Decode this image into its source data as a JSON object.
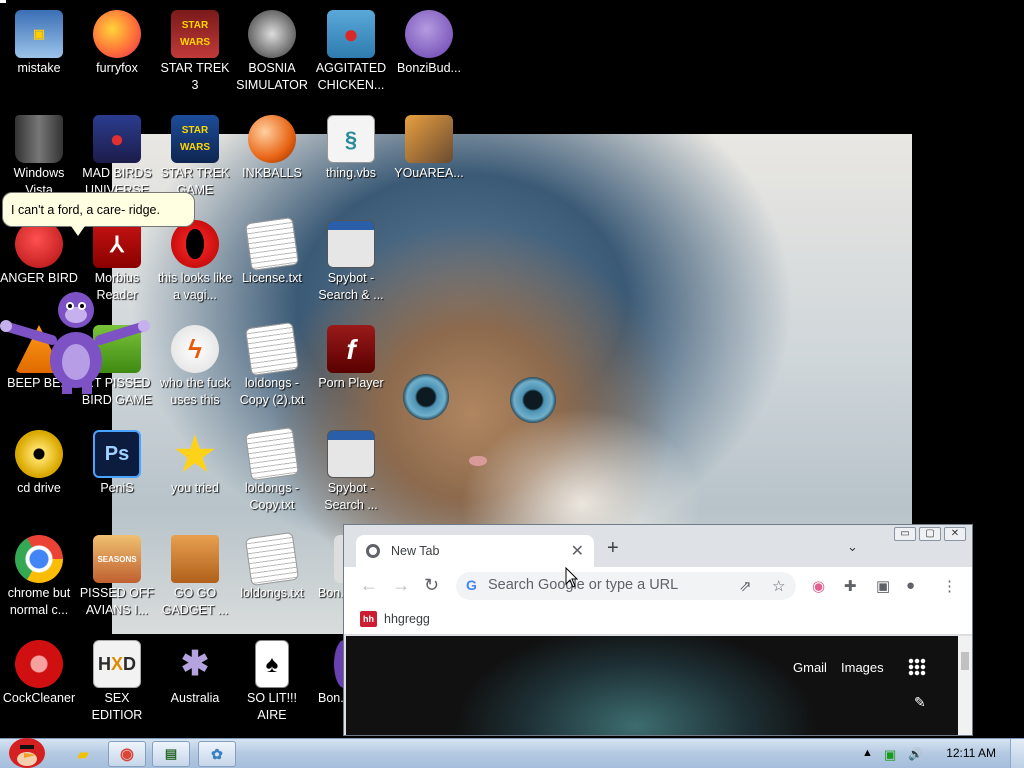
{
  "tooltip": {
    "text": "I can't a ford, a care- ridge."
  },
  "desktop_icons": [
    {
      "label": "mistake",
      "icon": "computer-icon"
    },
    {
      "label": "furryfox",
      "icon": "firefox-icon"
    },
    {
      "label": "STAR TREK 3",
      "icon": "star-wars-icon"
    },
    {
      "label": "BOSNIA SIMULATOR",
      "icon": "spiked-mine-icon"
    },
    {
      "label": "AGGITATED CHICKEN...",
      "icon": "angry-bird-icon"
    },
    {
      "label": "BonziBud...",
      "icon": "bonzi-icon"
    },
    {
      "label": "Windows Vista",
      "icon": "recycle-bin-icon"
    },
    {
      "label": "MAD BIRDS UNIVERSE",
      "icon": "angry-birds-space-icon"
    },
    {
      "label": "STAR TREK GAME",
      "icon": "star-wars-icon"
    },
    {
      "label": "INKBALLS",
      "icon": "inkball-icon"
    },
    {
      "label": "thing.vbs",
      "icon": "script-icon"
    },
    {
      "label": "YOuAREA...",
      "icon": "app-icon"
    },
    {
      "label": "ANGER BIRD",
      "icon": "angry-bird-icon"
    },
    {
      "label": "Morbius Reader",
      "icon": "pdf-reader-icon"
    },
    {
      "label": "this looks like a vagi...",
      "icon": "opera-icon"
    },
    {
      "label": "License.txt",
      "icon": "text-file-icon"
    },
    {
      "label": "Spybot - Search & ...",
      "icon": "spybot-icon"
    },
    {
      "label": "BEEP BE...",
      "icon": "vlc-icon"
    },
    {
      "label": "...T PISSED BIRD GAME",
      "icon": "angry-bird-icon"
    },
    {
      "label": "who the fuck uses this",
      "icon": "winamp-icon"
    },
    {
      "label": "loldongs - Copy (2).txt",
      "icon": "text-file-icon"
    },
    {
      "label": "Porn Player",
      "icon": "flash-icon"
    },
    {
      "label": "cd drive",
      "icon": "cd-icon"
    },
    {
      "label": "PeniS",
      "icon": "photoshop-icon"
    },
    {
      "label": "you tried",
      "icon": "star-icon"
    },
    {
      "label": "loldongs - Copy.txt",
      "icon": "text-file-icon"
    },
    {
      "label": "Spybot - Search ...",
      "icon": "spybot-icon"
    },
    {
      "label": "chrome but normal c...",
      "icon": "chrome-icon"
    },
    {
      "label": "PISSED OFF AVIANS I...",
      "icon": "angry-birds-seasons-icon"
    },
    {
      "label": "GO GO GADGET ...",
      "icon": "briefcase-icon"
    },
    {
      "label": "loldongs.txt",
      "icon": "text-file-icon"
    },
    {
      "label": "Bon...",
      "icon": "app-icon"
    },
    {
      "label": "CockCleaner",
      "icon": "ccleaner-icon"
    },
    {
      "label": "SEX EDITIOR",
      "icon": "hxd-icon"
    },
    {
      "label": "Australia",
      "icon": "spider-solitaire-icon"
    },
    {
      "label": "SO LIT!!! AIRE",
      "icon": "solitaire-icon"
    },
    {
      "label": "Bon...",
      "icon": "bonzi-icon"
    }
  ],
  "chrome": {
    "tab_title": "New Tab",
    "tab_close": "✕",
    "new_tab": "+",
    "omnibox_placeholder": "Search Google or type a URL",
    "bookmark_icon_text": "hh",
    "bookmark_label": "hhgregg",
    "ntp_links": [
      "Gmail",
      "Images"
    ],
    "window_controls": [
      "▭",
      "▢",
      "✕"
    ]
  },
  "taskbar": {
    "clock": "12:11 AM",
    "items": [
      "start-button",
      "explorer-icon",
      "chrome-icon",
      "terminal-icon",
      "paint-icon"
    ]
  }
}
